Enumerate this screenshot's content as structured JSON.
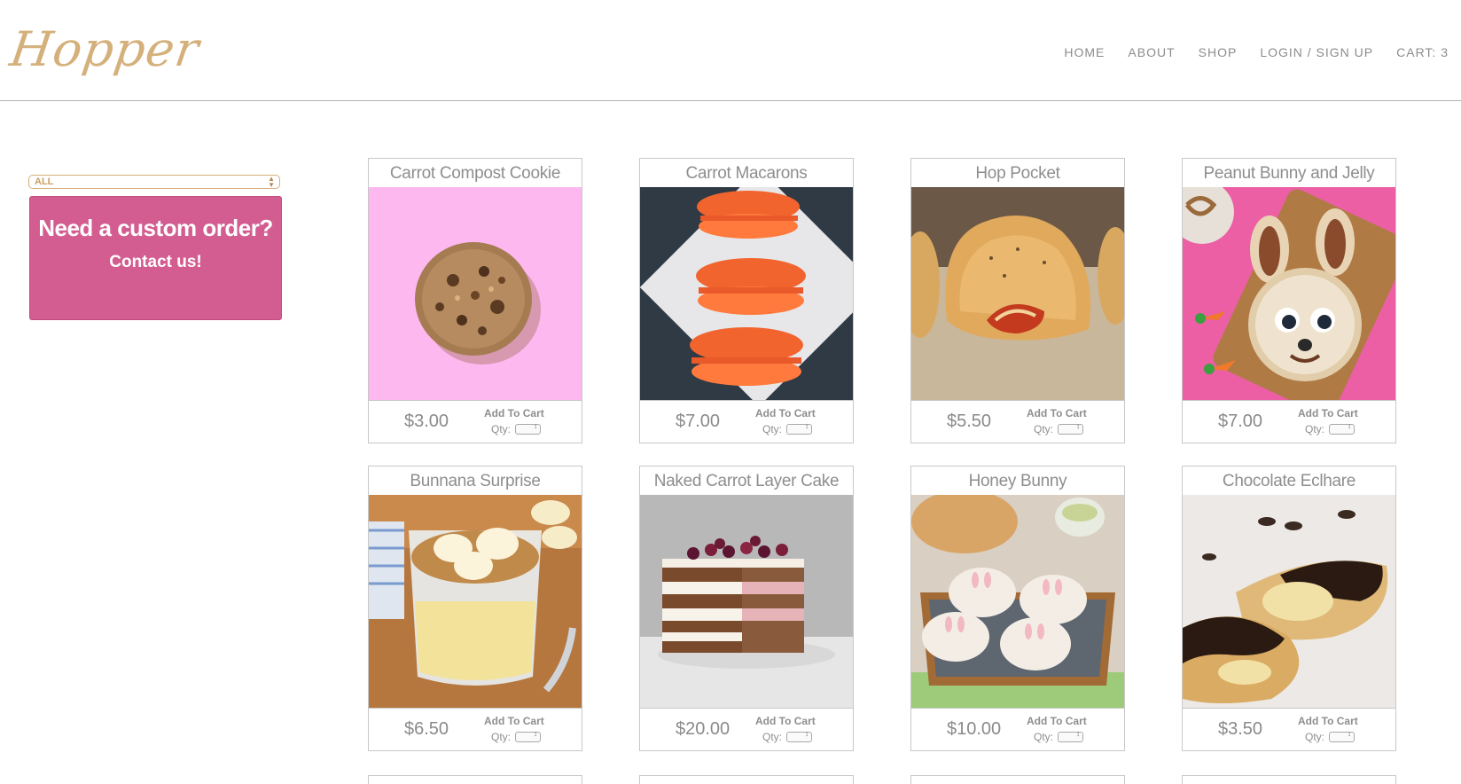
{
  "brand": {
    "logo_text": "Hopper"
  },
  "nav": {
    "items": [
      {
        "label": "HOME"
      },
      {
        "label": "ABOUT"
      },
      {
        "label": "SHOP"
      },
      {
        "label": "LOGIN / SIGN UP"
      },
      {
        "label": "CART: 3"
      }
    ]
  },
  "sidebar": {
    "filter": {
      "selected": "ALL"
    },
    "custom_order": {
      "title": "Need a custom order?",
      "link": "Contact us!"
    }
  },
  "products": [
    {
      "name": "Carrot Compost Cookie",
      "price": "$3.00",
      "image": "cookie",
      "add_label": "Add To Cart",
      "qty_label": "Qty:"
    },
    {
      "name": "Carrot Macarons",
      "price": "$7.00",
      "image": "macarons",
      "add_label": "Add To Cart",
      "qty_label": "Qty:"
    },
    {
      "name": "Hop Pocket",
      "price": "$5.50",
      "image": "pastry-pocket",
      "add_label": "Add To Cart",
      "qty_label": "Qty:"
    },
    {
      "name": "Peanut Bunny and Jelly",
      "price": "$7.00",
      "image": "bunny-sandwich",
      "add_label": "Add To Cart",
      "qty_label": "Qty:"
    },
    {
      "name": "Bunnana Surprise",
      "price": "$6.50",
      "image": "banana-pudding",
      "add_label": "Add To Cart",
      "qty_label": "Qty:"
    },
    {
      "name": "Naked Carrot Layer Cake",
      "price": "$20.00",
      "image": "layer-cake",
      "add_label": "Add To Cart",
      "qty_label": "Qty:"
    },
    {
      "name": "Honey Bunny",
      "price": "$10.00",
      "image": "bunny-buns",
      "add_label": "Add To Cart",
      "qty_label": "Qty:"
    },
    {
      "name": "Chocolate Eclhare",
      "price": "$3.50",
      "image": "eclair",
      "add_label": "Add To Cart",
      "qty_label": "Qty:"
    }
  ],
  "colors": {
    "accent_pink": "#d35c90",
    "logo_gold": "#d4b07a",
    "text_gray": "#8a8a8a",
    "border_gray": "#c8c8c8"
  }
}
